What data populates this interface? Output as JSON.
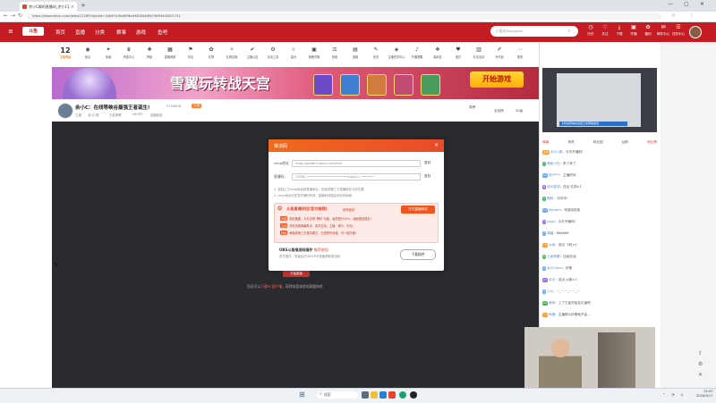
{
  "browser": {
    "tab_title": "余小C属的直播间_余小C属的视…",
    "tab_close": "×",
    "new_tab": "+",
    "url": "https://www.douyu.com/beta/11289?dyshid=1b0d7d-8ebf0fbcd4818eb3847b6f3a00001701",
    "nav": {
      "back": "←",
      "forward": "→",
      "reload": "↻"
    },
    "window_controls": {
      "minimize": "—",
      "maximize": "▢",
      "close": "✕"
    }
  },
  "site_header": {
    "logo": "斗鱼",
    "nav": [
      "首页",
      "直播",
      "分类",
      "赛事",
      "游戏",
      "鱼吧"
    ],
    "search_placeholder": "小菊花Babygone",
    "right_icons": [
      {
        "icon": "clock-icon",
        "label": "历史"
      },
      {
        "icon": "heart-icon",
        "label": "关注"
      },
      {
        "icon": "download-icon",
        "label": "下载"
      },
      {
        "icon": "video-icon",
        "label": "开播"
      },
      {
        "icon": "gift-icon",
        "label": "福利"
      },
      {
        "icon": "chat-icon",
        "label": "邮件中心"
      },
      {
        "icon": "menu-icon",
        "label": "任务中心"
      }
    ]
  },
  "toolbar": {
    "level": "12",
    "level_label": "主播等级",
    "items": [
      "鱼丸",
      "鱼塘",
      "贵族中心",
      "赞助",
      "直播间报",
      "车队",
      "礼物",
      "礼物召唤",
      "主播认证",
      "互动工具",
      "星光",
      "鱼粮兑换",
      "拍卖",
      "宝箱",
      "任务",
      "主播任务中心",
      "开播提醒",
      "福利区",
      "宝贝",
      "礼包活动",
      "写作品",
      "更多"
    ],
    "right_button": "PC客户端"
  },
  "banner": {
    "title": "雪翼玩转战天宫",
    "play_button": "开始游戏"
  },
  "room": {
    "streamer_title": "余小C：在线等峡谷最强王者诞生!",
    "streamer_tag": "主播",
    "meta": [
      "余小C属",
      "王者荣耀",
      "56956",
      "直播回放"
    ],
    "popularity": "3704658",
    "follow_label": "订阅",
    "fans_label": "全站榜",
    "rank_label": "周榜",
    "value_label": "20级"
  },
  "video": {
    "hint_prefix": "您还可以",
    "hint_link": "下载PC客户端",
    "hint_suffix": "，获得电竞体验的观看体验",
    "button_label": "开始直播"
  },
  "modal": {
    "title": "推流码",
    "close": "×",
    "rtmp_label": "rtmp地址：",
    "rtmp_value": "rtmp://sendtc1.douyu.com/live",
    "key_label": "直播码：",
    "key_value": "11289..•••••••••••••••••••••••&ssid=...•••••••",
    "copy_label": "复制",
    "notes": [
      "1. 复制上方rtmp地址和直播码后，粘贴到第三方直播软件对应位置",
      "2. rtmp地址仅在您开播时有效，直播码泄露后请及时刷新"
    ],
    "obs": {
      "title": "斗鱼直播伴侣(官方推荐)",
      "hint": "推荐使用",
      "open_button": "打开直播伴侣",
      "features": [
        {
          "tag": "功能",
          "text": "精彩截图、大礼包等“黑科”功能，画质提升20%，画面更加稳定!"
        },
        {
          "tag": "互动",
          "text": "伴侣内置弹幕助手，实时互动，主播、观众，可靠!"
        },
        {
          "tag": "特色",
          "text": "确保和第三方推流模式，无需额外设置，可一键开播!"
        }
      ]
    },
    "plugin": {
      "title": "OBS斗鱼推流码插件",
      "hint": "推荐使用",
      "desc": "官方插件，安装后在OBS中可快速获取推流码",
      "download_button": "下载插件"
    }
  },
  "right_column": {
    "tabs": [
      "弹幕",
      "贵宾",
      "粉丝团",
      "钻粉",
      "粉丝榜"
    ],
    "rank_title": "七周发现峡谷最强王者赛程收官",
    "chat": [
      {
        "badge": "主播",
        "user": "余小C属",
        "msg": "：今天开播啦!"
      },
      {
        "badge": "7",
        "user": "萌新小白",
        "msg": "：来了来了"
      },
      {
        "badge": "12",
        "user": "用户***",
        "msg": "：主播好帅"
      },
      {
        "badge": "8",
        "user": "快乐星球",
        "msg": "：送出 礼物×1"
      },
      {
        "badge": "5",
        "user": "默默",
        "msg": "：冲冲冲!"
      },
      {
        "badge": "14",
        "user": "fighters",
        "msg": "：哈哈哈哈哈"
      },
      {
        "badge": "3",
        "user": "pigpi",
        "msg": "：今天不播吗?"
      },
      {
        "badge": "2",
        "user": "弹幕",
        "msg": "：666666"
      },
      {
        "badge": "18",
        "user": "大树",
        "msg": "：送出 飞机×1"
      },
      {
        "badge": "9",
        "user": "王者荣耀",
        "msg": "：加油加油"
      },
      {
        "badge": "6",
        "user": "余小Cfans",
        "msg": "：好耶"
      },
      {
        "badge": "11",
        "user": "月光",
        "msg": "：送出 火箭×1"
      },
      {
        "badge": "4",
        "user": "小七",
        "msg": "：~_~ ~_~ ~_~"
      },
      {
        "badge": "13",
        "user": "清风",
        "msg": "：上了王者开始变天道吧"
      },
      {
        "badge": "15",
        "user": "阿狸",
        "msg": "：主播那么好看就不会…"
      }
    ],
    "gift_labels": [
      "礼物",
      "超级火箭"
    ]
  },
  "taskbar": {
    "search": "搜索",
    "time": "15:47",
    "date": "2024/3/17"
  }
}
